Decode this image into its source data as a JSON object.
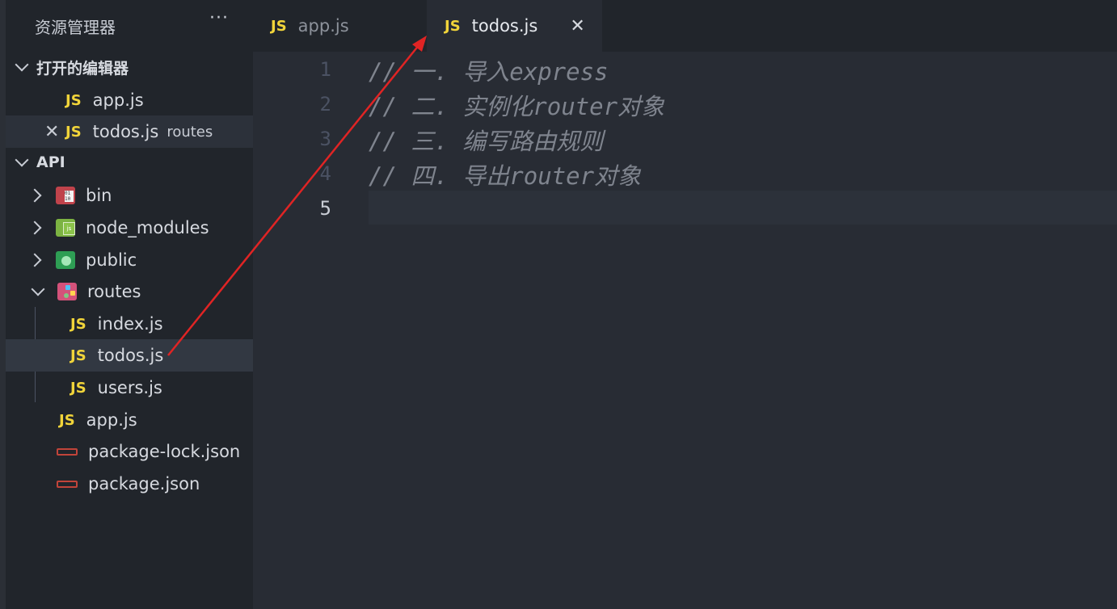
{
  "explorer": {
    "title": "资源管理器",
    "more": "···",
    "open_editors": {
      "header": "打开的编辑器",
      "items": [
        {
          "badge": "JS",
          "name": "app.js"
        },
        {
          "badge": "JS",
          "name": "todos.js",
          "desc": "routes",
          "close": "✕"
        }
      ]
    },
    "project": {
      "header": "API",
      "items": [
        {
          "name": "bin"
        },
        {
          "name": "node_modules"
        },
        {
          "name": "public"
        },
        {
          "name": "routes"
        },
        {
          "badge": "JS",
          "name": "index.js"
        },
        {
          "badge": "JS",
          "name": "todos.js"
        },
        {
          "badge": "JS",
          "name": "users.js"
        },
        {
          "badge": "JS",
          "name": "app.js"
        },
        {
          "name": "package-lock.json"
        },
        {
          "name": "package.json"
        }
      ]
    }
  },
  "tabs": [
    {
      "badge": "JS",
      "name": "app.js"
    },
    {
      "badge": "JS",
      "name": "todos.js",
      "close": "✕"
    }
  ],
  "editor": {
    "lines": [
      {
        "num": "1",
        "text": "// 一. 导入express"
      },
      {
        "num": "2",
        "text": "// 二. 实例化router对象"
      },
      {
        "num": "3",
        "text": "// 三. 编写路由规则"
      },
      {
        "num": "4",
        "text": "// 四. 导出router对象"
      },
      {
        "num": "5",
        "text": ""
      }
    ]
  },
  "colors": {
    "js_badge": "#f1d43a",
    "annotation_arrow": "#e02424",
    "comment": "#7f848e"
  }
}
